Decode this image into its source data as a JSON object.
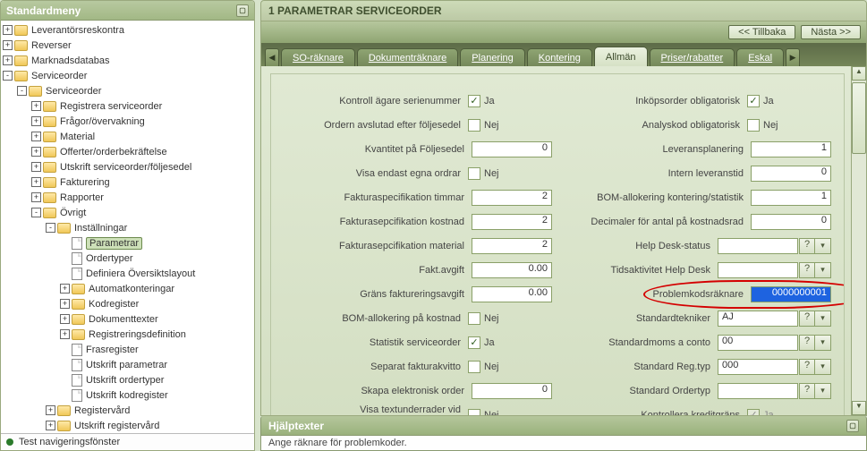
{
  "sidebar": {
    "title": "Standardmeny",
    "footer": "Test navigeringsfönster",
    "nodes": [
      {
        "depth": 0,
        "toggle": "+",
        "icon": "folder",
        "label": "Leverantörsreskontra"
      },
      {
        "depth": 0,
        "toggle": "+",
        "icon": "folder",
        "label": "Reverser"
      },
      {
        "depth": 0,
        "toggle": "+",
        "icon": "folder",
        "label": "Marknadsdatabas"
      },
      {
        "depth": 0,
        "toggle": "-",
        "icon": "folder",
        "label": "Serviceorder"
      },
      {
        "depth": 1,
        "toggle": "-",
        "icon": "folder",
        "label": "Serviceorder"
      },
      {
        "depth": 2,
        "toggle": "+",
        "icon": "folder",
        "label": "Registrera serviceorder"
      },
      {
        "depth": 2,
        "toggle": "+",
        "icon": "folder",
        "label": "Frågor/övervakning"
      },
      {
        "depth": 2,
        "toggle": "+",
        "icon": "folder",
        "label": "Material"
      },
      {
        "depth": 2,
        "toggle": "+",
        "icon": "folder",
        "label": "Offerter/orderbekräftelse"
      },
      {
        "depth": 2,
        "toggle": "+",
        "icon": "folder",
        "label": "Utskrift serviceorder/följesedel"
      },
      {
        "depth": 2,
        "toggle": "+",
        "icon": "folder",
        "label": "Fakturering"
      },
      {
        "depth": 2,
        "toggle": "+",
        "icon": "folder",
        "label": "Rapporter"
      },
      {
        "depth": 2,
        "toggle": "-",
        "icon": "folder",
        "label": "Övrigt"
      },
      {
        "depth": 3,
        "toggle": "-",
        "icon": "folder",
        "label": "Inställningar"
      },
      {
        "depth": 4,
        "toggle": " ",
        "icon": "page",
        "label": "Parametrar",
        "selected": true
      },
      {
        "depth": 4,
        "toggle": " ",
        "icon": "page",
        "label": "Ordertyper"
      },
      {
        "depth": 4,
        "toggle": " ",
        "icon": "page",
        "label": "Definiera Översiktslayout"
      },
      {
        "depth": 4,
        "toggle": "+",
        "icon": "folder",
        "label": "Automatkonteringar"
      },
      {
        "depth": 4,
        "toggle": "+",
        "icon": "folder",
        "label": "Kodregister"
      },
      {
        "depth": 4,
        "toggle": "+",
        "icon": "folder",
        "label": "Dokumenttexter"
      },
      {
        "depth": 4,
        "toggle": "+",
        "icon": "folder",
        "label": "Registreringsdefinition"
      },
      {
        "depth": 4,
        "toggle": " ",
        "icon": "page",
        "label": "Frasregister"
      },
      {
        "depth": 4,
        "toggle": " ",
        "icon": "page",
        "label": "Utskrift parametrar"
      },
      {
        "depth": 4,
        "toggle": " ",
        "icon": "page",
        "label": "Utskrift ordertyper"
      },
      {
        "depth": 4,
        "toggle": " ",
        "icon": "page",
        "label": "Utskrift kodregister"
      },
      {
        "depth": 3,
        "toggle": "+",
        "icon": "folder",
        "label": "Registervård"
      },
      {
        "depth": 3,
        "toggle": "+",
        "icon": "folder",
        "label": "Utskrift registervård"
      }
    ]
  },
  "header": {
    "title": "1 PARAMETRAR SERVICEORDER"
  },
  "nav": {
    "back": "<< Tillbaka",
    "next": "Nästa >>"
  },
  "tabs": [
    {
      "label": "SO-räknare"
    },
    {
      "label": "Dokumenträknare"
    },
    {
      "label": "Planering"
    },
    {
      "label": "Kontering"
    },
    {
      "label": "Allmän",
      "active": true
    },
    {
      "label": "Priser/rabatter"
    },
    {
      "label": "Eskal"
    }
  ],
  "form": {
    "left": [
      {
        "label": "Kontroll ägare serienummer",
        "type": "check",
        "checked": true,
        "text": "Ja"
      },
      {
        "label": "Ordern avslutad efter följesedel",
        "type": "check",
        "checked": false,
        "text": "Nej"
      },
      {
        "label": "Kvantitet på Följesedel",
        "type": "num",
        "value": "0"
      },
      {
        "label": "Visa endast egna ordrar",
        "type": "check",
        "checked": false,
        "text": "Nej"
      },
      {
        "label": "Fakturaspecifikation timmar",
        "type": "num",
        "value": "2"
      },
      {
        "label": "Fakturasepcifikation kostnad",
        "type": "num",
        "value": "2"
      },
      {
        "label": "Fakturasepcifikation material",
        "type": "num",
        "value": "2"
      },
      {
        "label": "Fakt.avgift",
        "type": "num",
        "value": "0.00"
      },
      {
        "label": "Gräns faktureringsavgift",
        "type": "num",
        "value": "0.00"
      },
      {
        "label": "BOM-allokering på kostnad",
        "type": "check",
        "checked": false,
        "text": "Nej"
      },
      {
        "label": "Statistik serviceorder",
        "type": "check",
        "checked": true,
        "text": "Ja"
      },
      {
        "label": "Separat fakturakvitto",
        "type": "check",
        "checked": false,
        "text": "Nej"
      },
      {
        "label": "Skapa elektronisk order",
        "type": "num",
        "value": "0"
      },
      {
        "label": "Visa textunderrader vid säljorderregistrering",
        "type": "check",
        "checked": false,
        "text": "Nej"
      }
    ],
    "right": [
      {
        "label": "Inköpsorder obligatorisk",
        "type": "check",
        "checked": true,
        "text": "Ja"
      },
      {
        "label": "Analyskod obligatorisk",
        "type": "check",
        "checked": false,
        "text": "Nej"
      },
      {
        "label": "Leveransplanering",
        "type": "num",
        "value": "1"
      },
      {
        "label": "Intern leveranstid",
        "type": "num",
        "value": "0"
      },
      {
        "label": "BOM-allokering kontering/statistik",
        "type": "num",
        "value": "1"
      },
      {
        "label": "Decimaler för antal på kostnadsrad",
        "type": "num",
        "value": "0"
      },
      {
        "label": "Help Desk-status",
        "type": "combo",
        "value": ""
      },
      {
        "label": "Tidsaktivitet Help Desk",
        "type": "combo",
        "value": ""
      },
      {
        "label": "Problemkodsräknare",
        "type": "num",
        "value": "0000000001",
        "circled": true,
        "selected": true
      },
      {
        "label": "Standardtekniker",
        "type": "combo",
        "value": "AJ"
      },
      {
        "label": "Standardmoms a conto",
        "type": "combo",
        "value": "00"
      },
      {
        "label": "Standard Reg.typ",
        "type": "combo",
        "value": "000"
      },
      {
        "label": "Standard Ordertyp",
        "type": "combo",
        "value": ""
      },
      {
        "label": "Kontrollera kreditgräns",
        "type": "check",
        "checked": true,
        "text": "Ja",
        "disabled": true
      }
    ]
  },
  "help": {
    "title": "Hjälptexter",
    "body": "Ange räknare för problemkoder."
  }
}
